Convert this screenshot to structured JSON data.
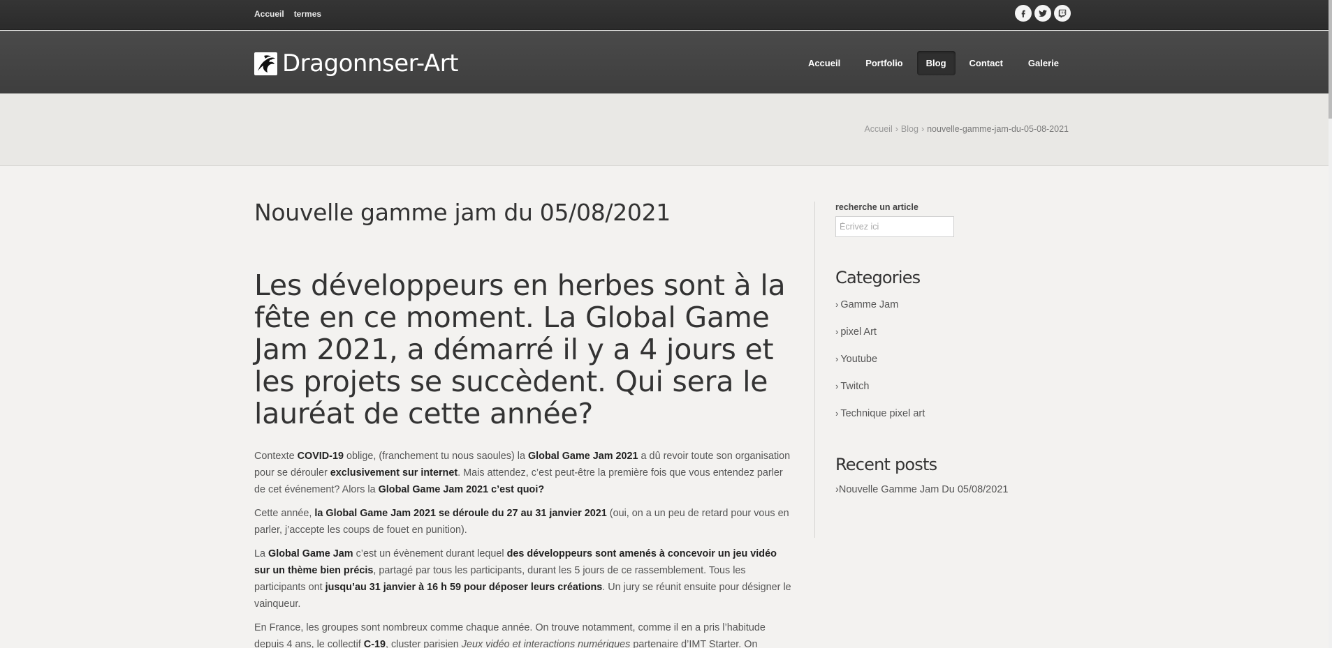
{
  "topbar": {
    "links": [
      "Accueil",
      "termes"
    ],
    "social_icons": [
      "facebook-icon",
      "twitter-icon",
      "twitch-icon"
    ]
  },
  "header": {
    "logo_text": "Dragonnser-Art",
    "nav": [
      "Accueil",
      "Portfolio",
      "Blog",
      "Contact",
      "Galerie"
    ],
    "active_nav": "Blog"
  },
  "breadcrumb": {
    "items": [
      "Accueil",
      "Blog"
    ],
    "current": "nouvelle-gamme-jam-du-05-08-2021"
  },
  "article": {
    "title": "Nouvelle gamme jam du 05/08/2021",
    "lead": "Les développeurs en herbes sont à la fête en ce moment. La Global Game Jam 2021, a démarré il y a 4 jours et les projets se succèdent. Qui sera le lauréat de cette année?",
    "paragraphs": [
      [
        {
          "t": "Contexte "
        },
        {
          "t": "COVID-19",
          "b": true
        },
        {
          "t": " oblige, (franchement tu nous saoules) la "
        },
        {
          "t": "Global Game Jam 2021",
          "b": true
        },
        {
          "t": " a dû revoir toute son organisation pour se dérouler "
        },
        {
          "t": "exclusivement sur internet",
          "b": true
        },
        {
          "t": ". Mais attendez, c’est peut-être la première fois que vous entendez parler de cet événement? Alors la "
        },
        {
          "t": "Global Game Jam 2021 c’est quoi?",
          "b": true
        }
      ],
      [
        {
          "t": "Cette année, "
        },
        {
          "t": "la Global Game Jam 2021 se déroule du 27 au 31 janvier 2021",
          "b": true
        },
        {
          "t": " (oui, on a un peu de retard pour vous en parler, j’accepte les coups de fouet en punition)."
        }
      ],
      [
        {
          "t": "La "
        },
        {
          "t": "Global Game Jam",
          "b": true
        },
        {
          "t": " c’est un évènement durant lequel "
        },
        {
          "t": "des développeurs sont amenés à concevoir un jeu vidéo sur un thème bien précis",
          "b": true
        },
        {
          "t": ", partagé par tous les participants, durant les 5 jours de ce rassemblement. Tous les participants ont "
        },
        {
          "t": "jusqu’au 31 janvier à 16 h 59 pour déposer leurs créations",
          "b": true
        },
        {
          "t": ". Un jury se réunit ensuite pour désigner le vainqueur."
        }
      ],
      [
        {
          "t": "En France, les groupes sont nombreux comme chaque année. On trouve notamment, comme il en a pris l’habitude depuis 4 ans, le collectif "
        },
        {
          "t": "C-19",
          "b": true
        },
        {
          "t": ", cluster parisien "
        },
        {
          "t": "Jeux vidéo et interactions numériques",
          "i": true
        },
        {
          "t": " partenaire d’IMT Starter. On"
        }
      ]
    ]
  },
  "sidebar": {
    "search_label": "recherche un article",
    "search_placeholder": "Écrivez ici",
    "categories_heading": "Categories",
    "categories": [
      "Gamme Jam",
      "pixel Art",
      "Youtube",
      "Twitch",
      "Technique pixel art"
    ],
    "recent_heading": "Recent posts",
    "recent_posts": [
      "Nouvelle Gamme Jam Du 05/08/2021"
    ]
  }
}
